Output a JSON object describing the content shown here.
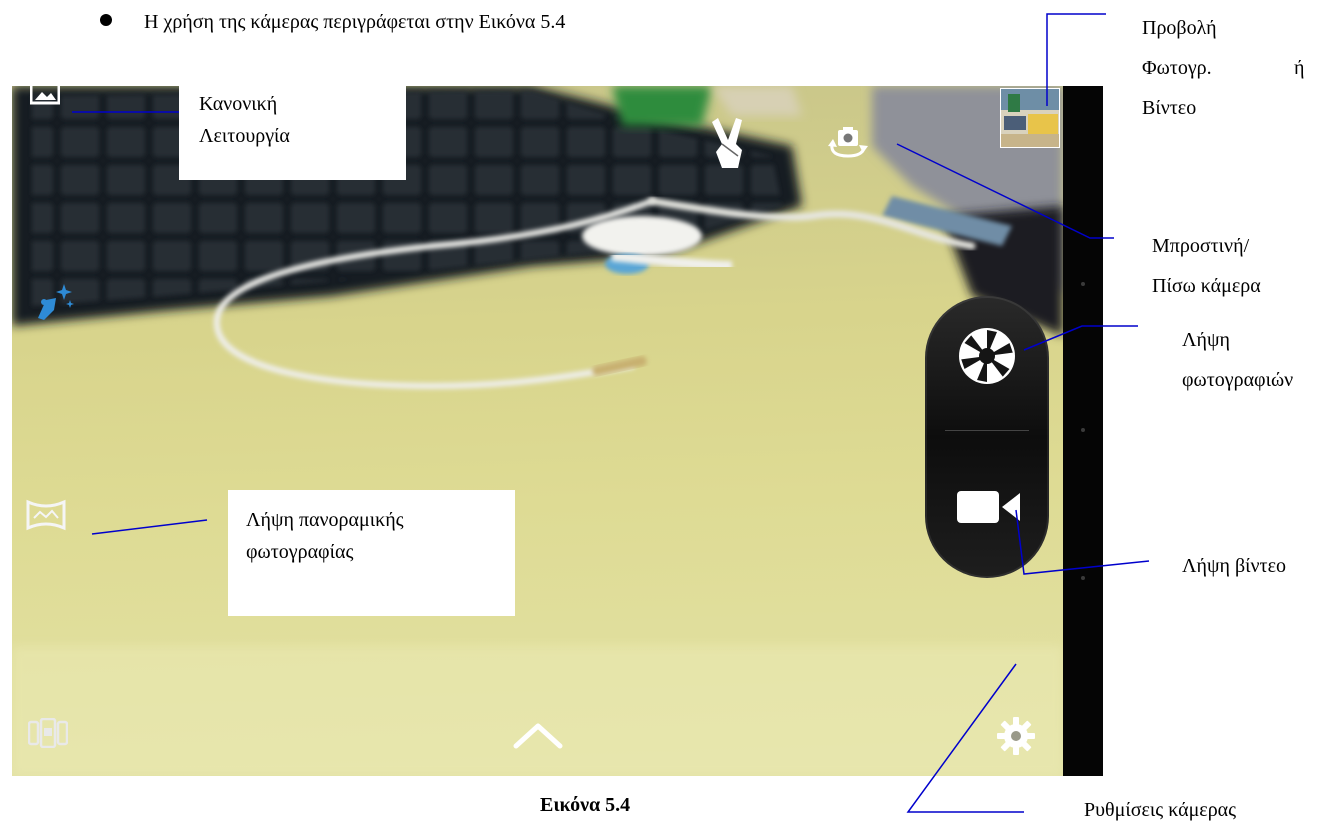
{
  "bullet_text": "Η χρήση της κάμερας περιγράφεται στην Εικόνα 5.4",
  "callouts": {
    "normal_mode": [
      "Κανονική",
      "Λειτουργία"
    ],
    "panorama": [
      "Λήψη πανοραμικής",
      "φωτογραφίας"
    ],
    "view_photo": [
      "Προβολή",
      "Φωτογρ.",
      "ή",
      "Βίντεο"
    ],
    "front_back": [
      "Μπροστινή/",
      "Πίσω κάμερα"
    ],
    "take_photo": [
      "Λήψη",
      "φωτογραφιών"
    ],
    "take_video": "Λήψη βίντεο",
    "settings": "Ρυθμίσεις κάμερας"
  },
  "caption": "Εικόνα 5.4",
  "icons": {
    "mode": "normal-mode-icon",
    "beauty": "magic-wand-icon",
    "panorama": "panorama-icon",
    "multi": "multi-frame-icon",
    "gesture": "gesture-hand-icon",
    "switch": "switch-camera-icon",
    "thumbnail": "gallery-thumbnail",
    "shutter": "shutter-icon",
    "video": "video-camera-icon",
    "expand": "chevron-up-icon",
    "settings": "gear-icon"
  },
  "colors": {
    "leader_line": "#0000cc",
    "beauty_icon": "#2e8bd6",
    "pill": "#111111"
  }
}
